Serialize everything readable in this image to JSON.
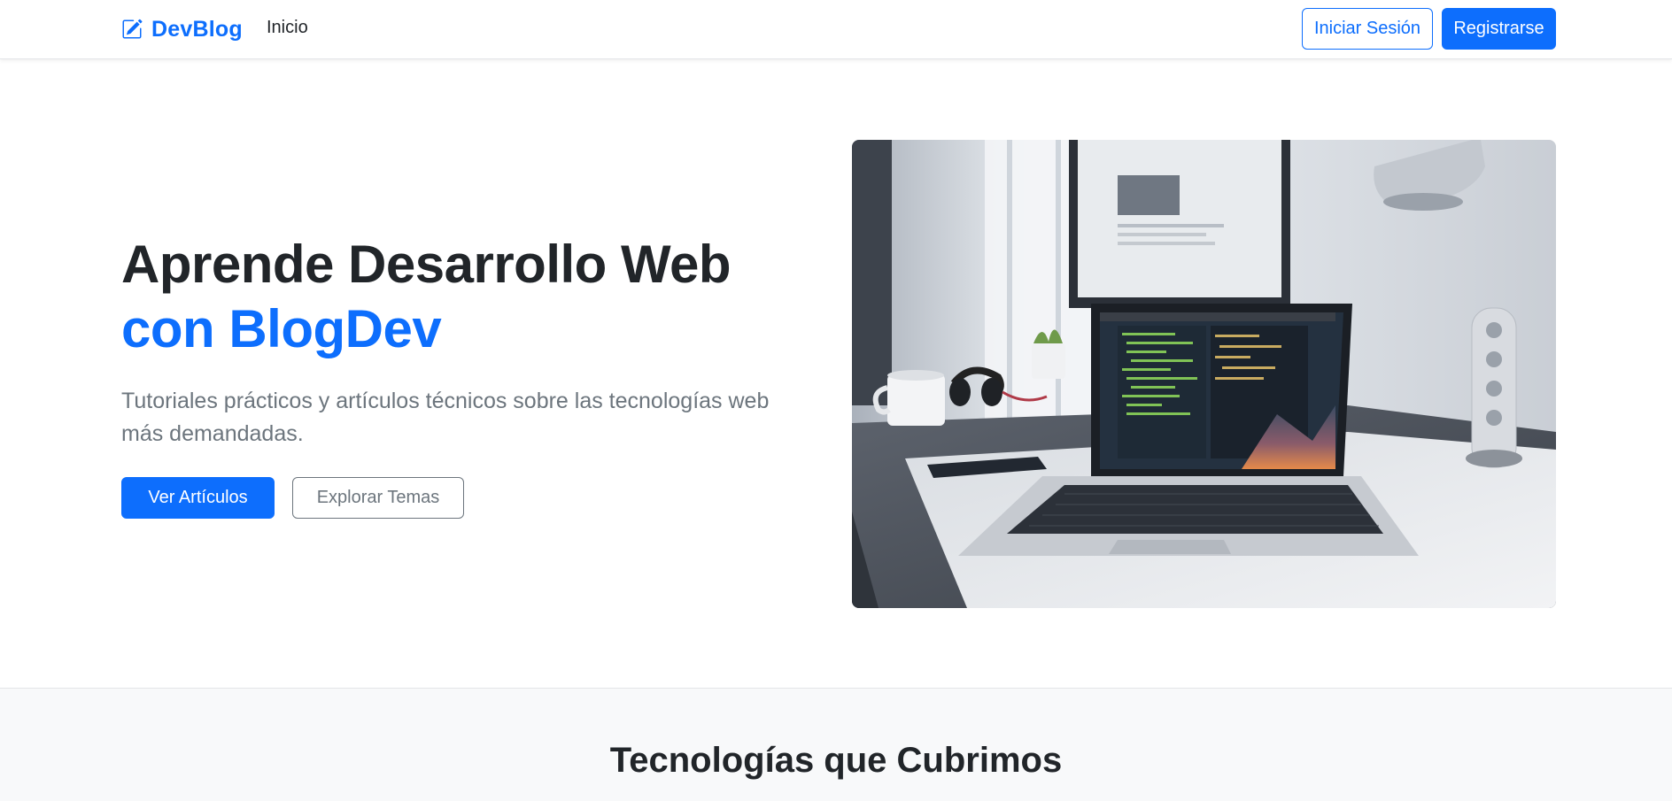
{
  "navbar": {
    "brand": {
      "icon": "pencil-square-icon",
      "name": "DevBlog"
    },
    "links": [
      {
        "label": "Inicio"
      }
    ],
    "login_label": "Iniciar Sesión",
    "register_label": "Registrarse"
  },
  "hero": {
    "title_line1": "Aprende Desarrollo Web",
    "title_line2": "con BlogDev",
    "lead": "Tutoriales prácticos y artículos técnicos sobre las tecnologías web más demandadas.",
    "primary_button": "Ver Artículos",
    "secondary_button": "Explorar Temas",
    "image_subject": "laptop-workspace-photo"
  },
  "tech_section": {
    "title": "Tecnologías que Cubrimos"
  },
  "colors": {
    "primary": "#0d6efd",
    "secondary": "#6c757d",
    "text": "#212529",
    "section_bg": "#f8f9fa"
  }
}
